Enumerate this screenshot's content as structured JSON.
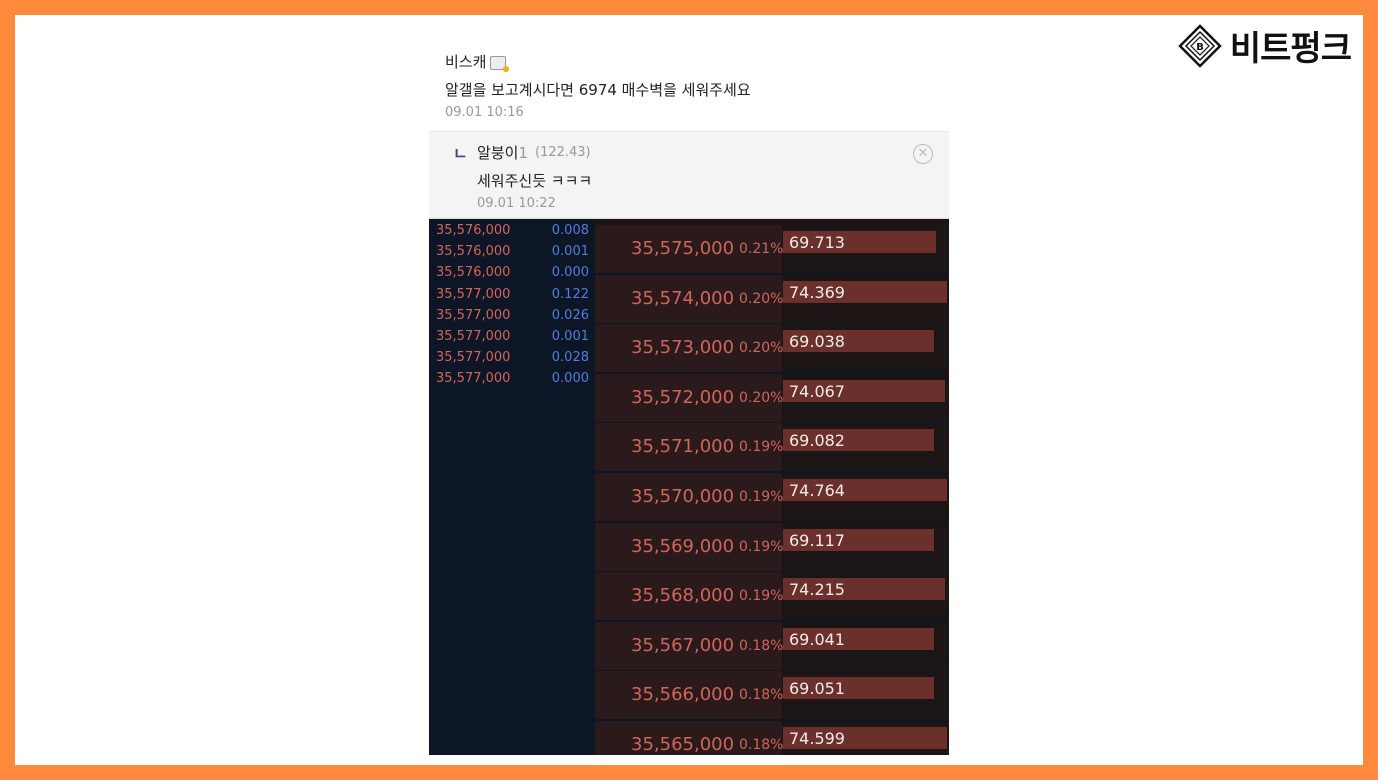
{
  "brand": {
    "name": "비트펑크",
    "logo_letter": "B"
  },
  "comments": [
    {
      "author": "비스캐",
      "text": "알갤을 보고계시다면 6974 매수벽을 세워주세요",
      "time": "09.01 10:16"
    },
    {
      "author": "알붕이",
      "rank": "1",
      "score": "(122.43)",
      "text": "세워주신듯 ㅋㅋㅋ",
      "time": "09.01 10:22"
    }
  ],
  "icons": {
    "reply": "reply-arrow-icon",
    "close": "close-circle-icon",
    "badge": "user-badge-icon"
  },
  "trades": [
    {
      "price": "35,576,000",
      "qty": "0.008"
    },
    {
      "price": "35,576,000",
      "qty": "0.001"
    },
    {
      "price": "35,576,000",
      "qty": "0.000"
    },
    {
      "price": "35,577,000",
      "qty": "0.122"
    },
    {
      "price": "35,577,000",
      "qty": "0.026"
    },
    {
      "price": "35,577,000",
      "qty": "0.001"
    },
    {
      "price": "35,577,000",
      "qty": "0.028"
    },
    {
      "price": "35,577,000",
      "qty": "0.000"
    }
  ],
  "orderbook": [
    {
      "price": "35,575,000",
      "pct": "0.21%",
      "qty": "69.713",
      "fill": 0.93
    },
    {
      "price": "35,574,000",
      "pct": "0.20%",
      "qty": "74.369",
      "fill": 1.0
    },
    {
      "price": "35,573,000",
      "pct": "0.20%",
      "qty": "69.038",
      "fill": 0.92
    },
    {
      "price": "35,572,000",
      "pct": "0.20%",
      "qty": "74.067",
      "fill": 0.99
    },
    {
      "price": "35,571,000",
      "pct": "0.19%",
      "qty": "69.082",
      "fill": 0.92
    },
    {
      "price": "35,570,000",
      "pct": "0.19%",
      "qty": "74.764",
      "fill": 1.0
    },
    {
      "price": "35,569,000",
      "pct": "0.19%",
      "qty": "69.117",
      "fill": 0.92
    },
    {
      "price": "35,568,000",
      "pct": "0.19%",
      "qty": "74.215",
      "fill": 0.99
    },
    {
      "price": "35,567,000",
      "pct": "0.18%",
      "qty": "69.041",
      "fill": 0.92
    },
    {
      "price": "35,566,000",
      "pct": "0.18%",
      "qty": "69.051",
      "fill": 0.92
    },
    {
      "price": "35,565,000",
      "pct": "0.18%",
      "qty": "74.599",
      "fill": 1.0
    }
  ],
  "colors": {
    "frame": "#ff8a3d",
    "ask_text": "#d0655a",
    "bid_qty": "#4f7fd8",
    "bar": "#6b2f2c"
  }
}
